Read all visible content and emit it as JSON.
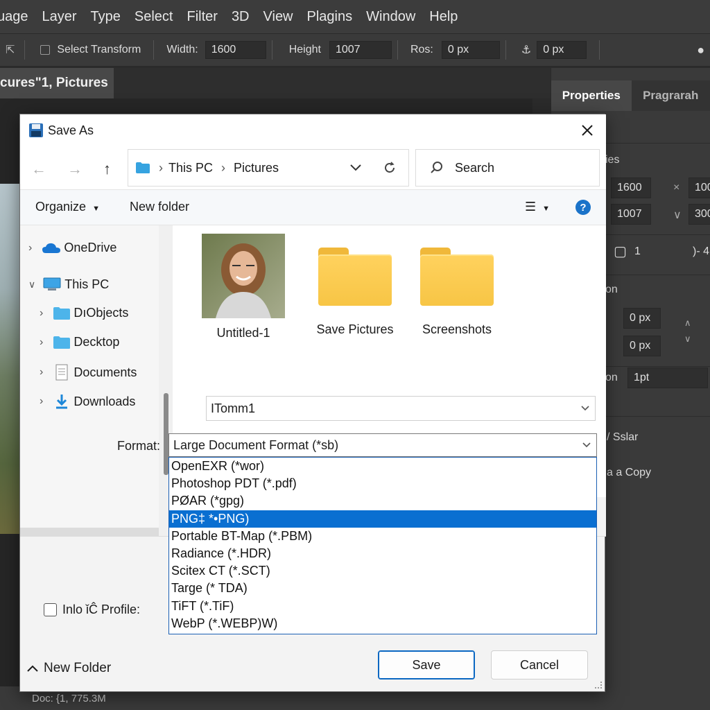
{
  "menubar": {
    "items": [
      "uage",
      "Layer",
      "Type",
      "Select",
      "Filter",
      "3D",
      "View",
      "Plagins",
      "Window",
      "Help"
    ]
  },
  "optionsbar": {
    "select_transform_label": "Select Transform",
    "width_label": "Width:",
    "width_value": "1600",
    "height_label": "Height",
    "height_value": "1007",
    "ros_label": "Ros:",
    "ros_value": "0 px",
    "extra_value": "0 px"
  },
  "document_tab": {
    "title": "cures\"1, Pictures"
  },
  "statusbar": {
    "doc_info": "Doc: {1, 775.3M"
  },
  "right_panel": {
    "tabs": [
      "Properties",
      "Pragrarah"
    ],
    "section1_label": "ies",
    "w_value": "1600",
    "w_value2": "100",
    "h_value": "1007",
    "h_value2": "300",
    "corner_value": "1",
    "corner_suffix": ")- 4",
    "section2_label": "on",
    "x_value": "0 px",
    "y_value": "0 px",
    "section3_label": "on",
    "stroke_value": "1pt",
    "opt1": "/ Sslar",
    "opt2": "a a Copy"
  },
  "dialog": {
    "title": "Save As",
    "address": {
      "root": "This PC",
      "folder": "Pictures"
    },
    "search_placeholder": "Search",
    "organize_label": "Organize",
    "new_folder_label": "New folder",
    "nav_items": [
      {
        "label": "OneDrive",
        "icon": "cloud-icon"
      },
      {
        "label": "This PC",
        "icon": "computer-icon"
      },
      {
        "label": "DıObjects",
        "icon": "folder-icon"
      },
      {
        "label": "Decktop",
        "icon": "folder-icon"
      },
      {
        "label": "Documents",
        "icon": "document-icon"
      },
      {
        "label": "Downloads",
        "icon": "download-icon"
      }
    ],
    "files": [
      {
        "name": "Untitled-1",
        "type": "image"
      },
      {
        "name": "Save Pictures",
        "type": "folder"
      },
      {
        "name": "Screenshots",
        "type": "folder"
      }
    ],
    "filename_value": "ITomm1",
    "format_label": "Format:",
    "format_selected": "Large Document Format (*sb)",
    "format_options": [
      "OpenEXR (*wor)",
      "Photoshop PDT (*.pdf)",
      "PØAR (*gpg)",
      "PNG‡ *•PNG)",
      "Portable BT-Map (*.PBM)",
      "Radiance (*.HDR)",
      "Scitex CT (*.SCT)",
      "Targe (* TDA)",
      "TiFT (*.TiF)",
      "WebP (*.WEBP)W)"
    ],
    "format_highlighted_index": 3,
    "icc_label": "Inlo ǐĈ Profile:",
    "hide_folders_label": "New Folder",
    "save_label": "Save",
    "cancel_label": "Cancel"
  },
  "colors": {
    "accent": "#0a6fd1",
    "chrome_bg": "#3c3c3c",
    "dialog_bg": "#f3f3f3",
    "folder": "#f7c545"
  }
}
